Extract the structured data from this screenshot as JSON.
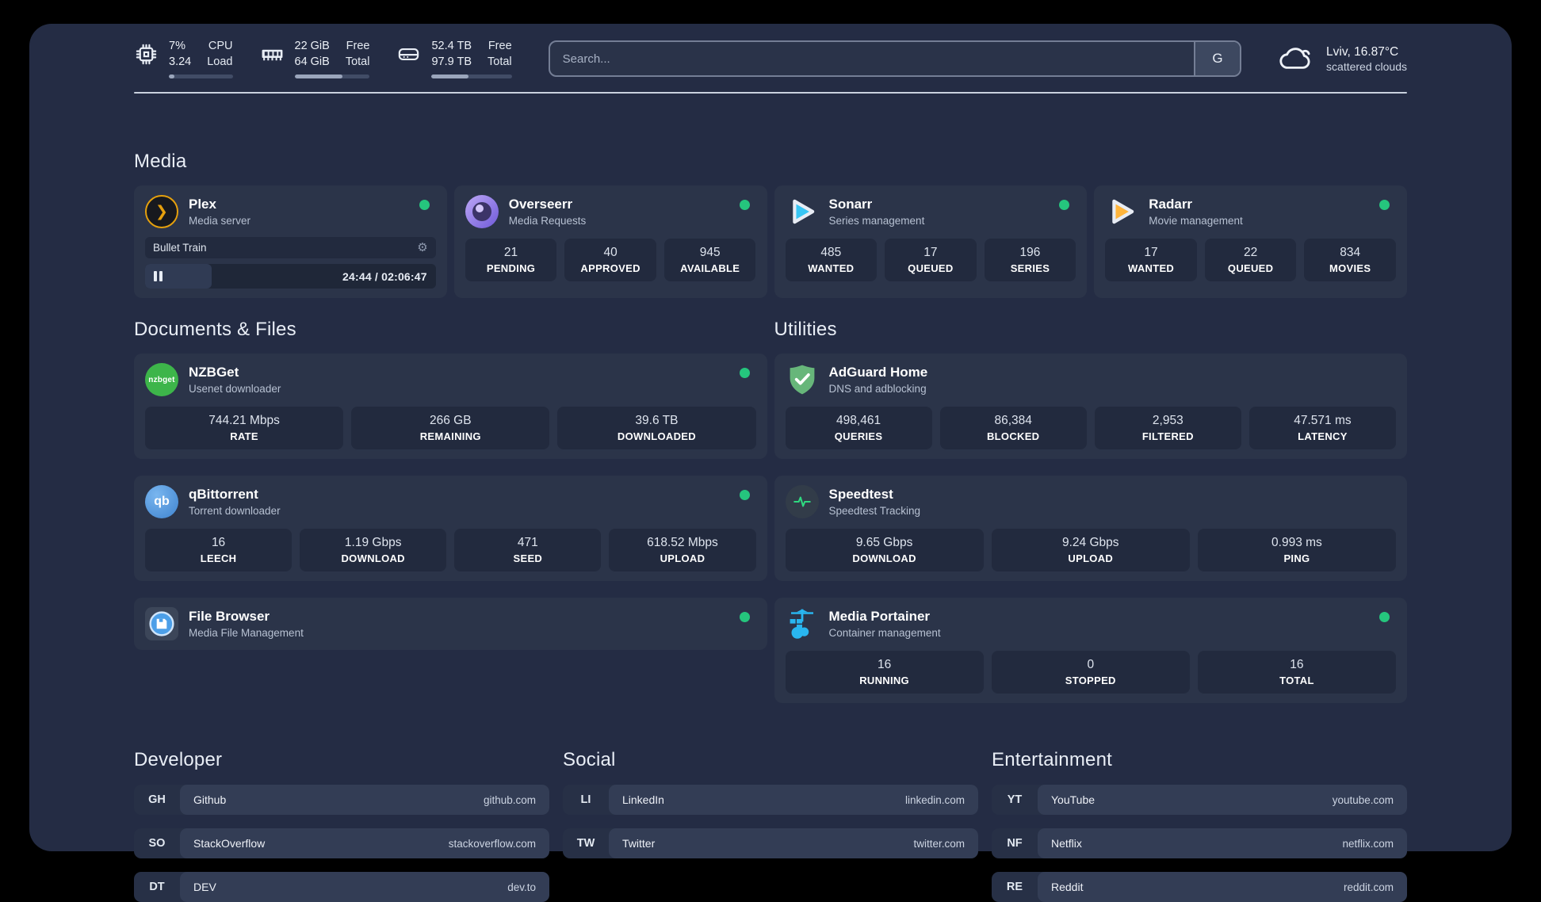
{
  "colors": {
    "status-green": "#25c57d",
    "plex-orange": "#e5a00d",
    "sonarr-blue": "#38c6f4",
    "radarr-yellow": "#ffb53c",
    "nzbget-green": "#3db54a",
    "qbittorrent-blue": "#4a90d9",
    "filebrowser-blue": "#4c9fe8",
    "adguard-green": "#67b67a",
    "overseerr-purple": "#7c5cbf",
    "speedtest-green": "#2fd980",
    "portainer-blue": "#29b6f0"
  },
  "header": {
    "stats": [
      {
        "values": [
          "7%",
          "3.24"
        ],
        "labels": [
          "CPU",
          "Load"
        ],
        "progress_pct": 9
      },
      {
        "values": [
          "22 GiB",
          "64 GiB"
        ],
        "labels": [
          "Free",
          "Total"
        ],
        "progress_pct": 64
      },
      {
        "values": [
          "52.4 TB",
          "97.9 TB"
        ],
        "labels": [
          "Free",
          "Total"
        ],
        "progress_pct": 46
      }
    ],
    "search": {
      "placeholder": "Search...",
      "button": "G"
    },
    "weather": {
      "location": "Lviv, 16.87°C",
      "condition": "scattered clouds"
    }
  },
  "media": {
    "title": "Media",
    "plex": {
      "name": "Plex",
      "desc": "Media server",
      "now_playing": "Bullet Train",
      "time": "24:44 / 02:06:47",
      "progress_pct": 20
    },
    "overseerr": {
      "name": "Overseerr",
      "desc": "Media Requests",
      "stats": [
        {
          "value": "21",
          "label": "PENDING"
        },
        {
          "value": "40",
          "label": "APPROVED"
        },
        {
          "value": "945",
          "label": "AVAILABLE"
        }
      ]
    },
    "sonarr": {
      "name": "Sonarr",
      "desc": "Series management",
      "stats": [
        {
          "value": "485",
          "label": "WANTED"
        },
        {
          "value": "17",
          "label": "QUEUED"
        },
        {
          "value": "196",
          "label": "SERIES"
        }
      ]
    },
    "radarr": {
      "name": "Radarr",
      "desc": "Movie management",
      "stats": [
        {
          "value": "17",
          "label": "WANTED"
        },
        {
          "value": "22",
          "label": "QUEUED"
        },
        {
          "value": "834",
          "label": "MOVIES"
        }
      ]
    }
  },
  "documents": {
    "title": "Documents & Files",
    "nzbget": {
      "name": "NZBGet",
      "desc": "Usenet downloader",
      "icon_text": "nzbget",
      "stats": [
        {
          "value": "744.21 Mbps",
          "label": "RATE"
        },
        {
          "value": "266 GB",
          "label": "REMAINING"
        },
        {
          "value": "39.6 TB",
          "label": "DOWNLOADED"
        }
      ]
    },
    "qbittorrent": {
      "name": "qBittorrent",
      "desc": "Torrent downloader",
      "icon_text": "qb",
      "stats": [
        {
          "value": "16",
          "label": "LEECH"
        },
        {
          "value": "1.19 Gbps",
          "label": "DOWNLOAD"
        },
        {
          "value": "471",
          "label": "SEED"
        },
        {
          "value": "618.52 Mbps",
          "label": "UPLOAD"
        }
      ]
    },
    "filebrowser": {
      "name": "File Browser",
      "desc": "Media File Management"
    }
  },
  "utilities": {
    "title": "Utilities",
    "adguard": {
      "name": "AdGuard Home",
      "desc": "DNS and adblocking",
      "stats": [
        {
          "value": "498,461",
          "label": "QUERIES"
        },
        {
          "value": "86,384",
          "label": "BLOCKED"
        },
        {
          "value": "2,953",
          "label": "FILTERED"
        },
        {
          "value": "47.571 ms",
          "label": "LATENCY"
        }
      ]
    },
    "speedtest": {
      "name": "Speedtest",
      "desc": "Speedtest Tracking",
      "stats": [
        {
          "value": "9.65 Gbps",
          "label": "DOWNLOAD"
        },
        {
          "value": "9.24 Gbps",
          "label": "UPLOAD"
        },
        {
          "value": "0.993 ms",
          "label": "PING"
        }
      ]
    },
    "portainer": {
      "name": "Media Portainer",
      "desc": "Container management",
      "stats": [
        {
          "value": "16",
          "label": "RUNNING"
        },
        {
          "value": "0",
          "label": "STOPPED"
        },
        {
          "value": "16",
          "label": "TOTAL"
        }
      ]
    }
  },
  "links": {
    "developer": {
      "title": "Developer",
      "items": [
        {
          "abbr": "GH",
          "name": "Github",
          "url": "github.com"
        },
        {
          "abbr": "SO",
          "name": "StackOverflow",
          "url": "stackoverflow.com"
        },
        {
          "abbr": "DT",
          "name": "DEV",
          "url": "dev.to"
        }
      ]
    },
    "social": {
      "title": "Social",
      "items": [
        {
          "abbr": "LI",
          "name": "LinkedIn",
          "url": "linkedin.com"
        },
        {
          "abbr": "TW",
          "name": "Twitter",
          "url": "twitter.com"
        }
      ]
    },
    "entertainment": {
      "title": "Entertainment",
      "items": [
        {
          "abbr": "YT",
          "name": "YouTube",
          "url": "youtube.com"
        },
        {
          "abbr": "NF",
          "name": "Netflix",
          "url": "netflix.com"
        },
        {
          "abbr": "RE",
          "name": "Reddit",
          "url": "reddit.com"
        }
      ]
    }
  }
}
